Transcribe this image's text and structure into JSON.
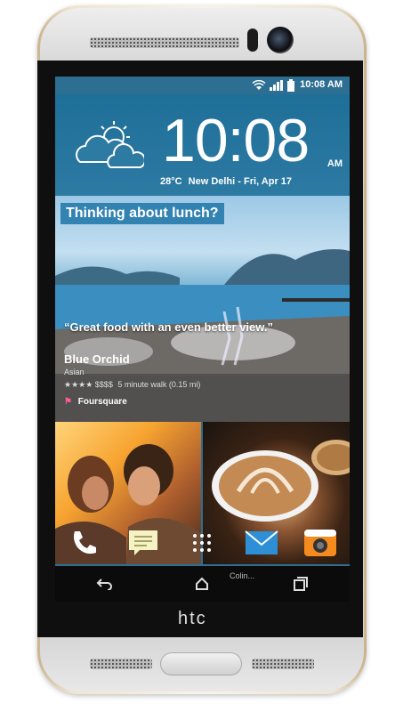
{
  "status_bar": {
    "time": "10:08 AM"
  },
  "clock_widget": {
    "time": "10:08",
    "ampm": "AM",
    "temperature": "28°C",
    "location": "New Delhi",
    "date": "Fri, Apr 17",
    "weather_icon": "partly-cloudy-icon"
  },
  "feed_card": {
    "banner": "Thinking about lunch?",
    "quote": "“Great food with an even better view.”",
    "place_name": "Blue Orchid",
    "category": "Asian",
    "rating_stars": "★★★★",
    "price": "$$$$",
    "distance": "5 minute walk (0.15 mi)",
    "source": "Foursquare"
  },
  "dock": [
    {
      "name": "phone-icon"
    },
    {
      "name": "messages-icon"
    },
    {
      "name": "app-drawer-icon"
    },
    {
      "name": "mail-icon"
    },
    {
      "name": "camera-icon"
    }
  ],
  "notification": {
    "text": "Colin..."
  },
  "brand": {
    "text": "htc"
  }
}
